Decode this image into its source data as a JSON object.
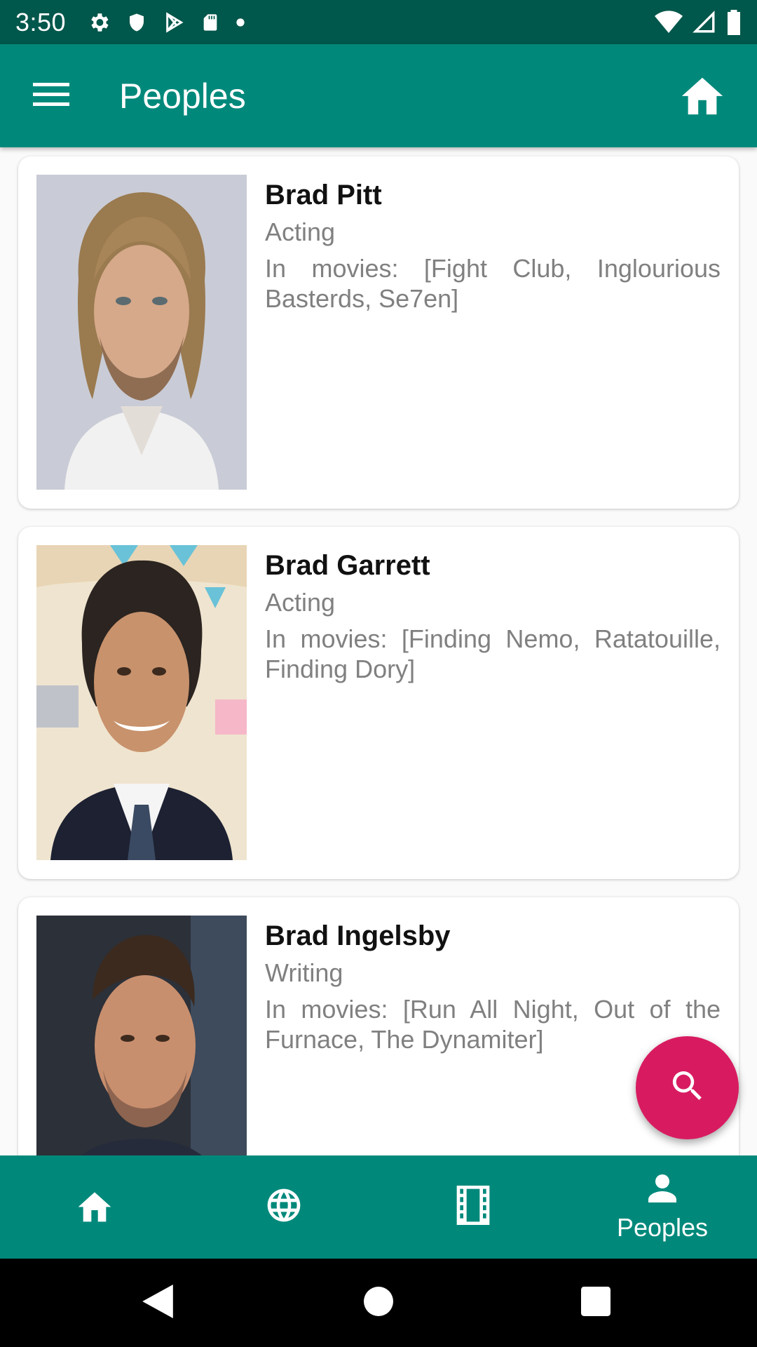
{
  "status_bar": {
    "time": "3:50"
  },
  "app_bar": {
    "title": "Peoples"
  },
  "people": [
    {
      "name": "Brad Pitt",
      "department": "Acting",
      "movies": "In movies: [Fight Club, Inglourious Basterds, Se7en]"
    },
    {
      "name": "Brad Garrett",
      "department": "Acting",
      "movies": "In movies: [Finding Nemo, Ratatouille, Finding Dory]"
    },
    {
      "name": "Brad Ingelsby",
      "department": "Writing",
      "movies": "In movies: [Run All Night, Out of the Furnace, The Dynamiter]"
    }
  ],
  "bottom_nav": {
    "active_label": "Peoples"
  },
  "colors": {
    "primary": "#00897b",
    "primary_dark": "#00574b",
    "accent": "#d81b60"
  }
}
